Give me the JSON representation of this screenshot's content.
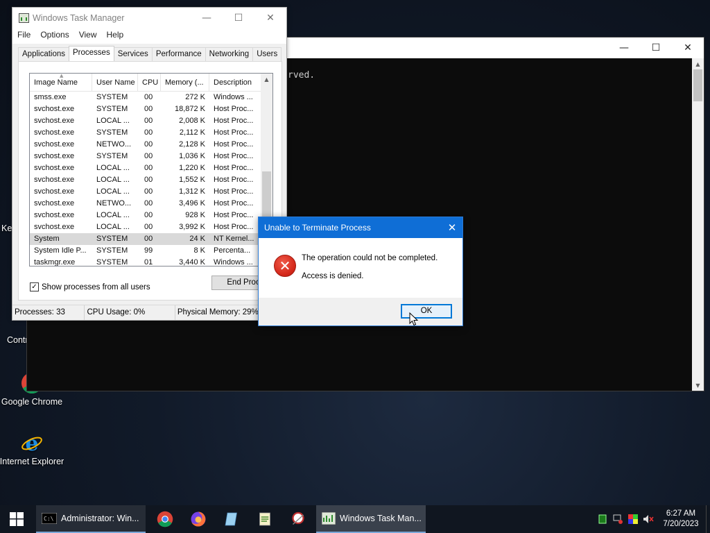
{
  "desktop": {
    "icons": [
      {
        "label": "Google Chrome"
      },
      {
        "label": "Internet Explorer"
      }
    ],
    "partial_labels": [
      "Key",
      "Contr"
    ]
  },
  "cmd": {
    "visible_text": "rved.",
    "controls": {
      "minimize": "—",
      "maximize": "☐",
      "close": "✕"
    }
  },
  "taskmanager": {
    "title": "Windows Task Manager",
    "controls": {
      "minimize": "—",
      "maximize": "☐",
      "close": "✕"
    },
    "menu": [
      "File",
      "Options",
      "View",
      "Help"
    ],
    "tabs": [
      "Applications",
      "Processes",
      "Services",
      "Performance",
      "Networking",
      "Users"
    ],
    "active_tab": "Processes",
    "columns": [
      "Image Name",
      "User Name",
      "CPU",
      "Memory (...",
      "Description"
    ],
    "rows": [
      {
        "name": "smss.exe",
        "user": "SYSTEM",
        "cpu": "00",
        "mem": "272 K",
        "desc": "Windows ..."
      },
      {
        "name": "svchost.exe",
        "user": "SYSTEM",
        "cpu": "00",
        "mem": "18,872 K",
        "desc": "Host Proc..."
      },
      {
        "name": "svchost.exe",
        "user": "LOCAL ...",
        "cpu": "00",
        "mem": "2,008 K",
        "desc": "Host Proc..."
      },
      {
        "name": "svchost.exe",
        "user": "SYSTEM",
        "cpu": "00",
        "mem": "2,112 K",
        "desc": "Host Proc..."
      },
      {
        "name": "svchost.exe",
        "user": "NETWO...",
        "cpu": "00",
        "mem": "2,128 K",
        "desc": "Host Proc..."
      },
      {
        "name": "svchost.exe",
        "user": "SYSTEM",
        "cpu": "00",
        "mem": "1,036 K",
        "desc": "Host Proc..."
      },
      {
        "name": "svchost.exe",
        "user": "LOCAL ...",
        "cpu": "00",
        "mem": "1,220 K",
        "desc": "Host Proc..."
      },
      {
        "name": "svchost.exe",
        "user": "LOCAL ...",
        "cpu": "00",
        "mem": "1,552 K",
        "desc": "Host Proc..."
      },
      {
        "name": "svchost.exe",
        "user": "LOCAL ...",
        "cpu": "00",
        "mem": "1,312 K",
        "desc": "Host Proc..."
      },
      {
        "name": "svchost.exe",
        "user": "NETWO...",
        "cpu": "00",
        "mem": "3,496 K",
        "desc": "Host Proc..."
      },
      {
        "name": "svchost.exe",
        "user": "LOCAL ...",
        "cpu": "00",
        "mem": "928 K",
        "desc": "Host Proc..."
      },
      {
        "name": "svchost.exe",
        "user": "LOCAL ...",
        "cpu": "00",
        "mem": "3,992 K",
        "desc": "Host Proc..."
      },
      {
        "name": "System",
        "user": "SYSTEM",
        "cpu": "00",
        "mem": "24 K",
        "desc": "NT Kernel...",
        "selected": true
      },
      {
        "name": "System Idle P...",
        "user": "SYSTEM",
        "cpu": "99",
        "mem": "8 K",
        "desc": "Percenta..."
      },
      {
        "name": "taskmgr.exe",
        "user": "SYSTEM",
        "cpu": "01",
        "mem": "3,440 K",
        "desc": "Windows ..."
      }
    ],
    "show_all_label": "Show processes from all users",
    "show_all_checked": "✓",
    "end_process_label": "End Process",
    "status": {
      "processes": "Processes: 33",
      "cpu": "CPU Usage: 0%",
      "memory": "Physical Memory: 29%"
    }
  },
  "dialog": {
    "title": "Unable to Terminate Process",
    "close": "✕",
    "icon_glyph": "✕",
    "message1": "The operation could not be completed.",
    "message2": "Access is denied.",
    "ok_label": "OK"
  },
  "taskbar": {
    "items": [
      {
        "label": "Administrator: Win..."
      },
      {
        "label": "Windows Task Man..."
      }
    ],
    "time": "6:27 AM",
    "date": "7/20/2023"
  },
  "colors": {
    "dialog_title": "#0f6ed6",
    "ok_border": "#0078d7",
    "error_red": "#d4281a",
    "taskbar": "#101620"
  }
}
